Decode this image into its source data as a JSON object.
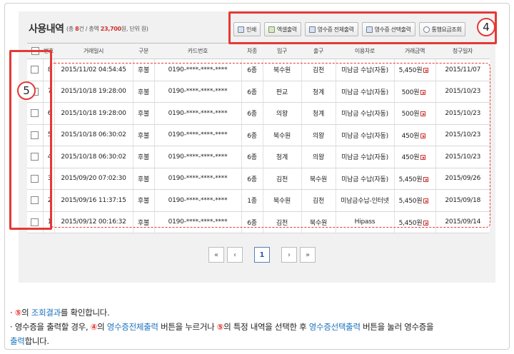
{
  "header": {
    "title": "사용내역",
    "summary_pre": "(총 ",
    "count": "8",
    "summary_mid": "건 / 총액 ",
    "total": "23,700",
    "summary_post": "원, 단위 원)"
  },
  "toolbar": {
    "print": "인쇄",
    "excel": "엑셀출력",
    "receipt_all": "영수증 전체출력",
    "receipt_selected": "영수증 선택출력",
    "fare_search": "통행요금조회"
  },
  "callouts": {
    "c4": "4",
    "c5": "5"
  },
  "table": {
    "headers": [
      "번호",
      "거래일시",
      "구분",
      "카드번호",
      "차종",
      "입구",
      "출구",
      "이용차로",
      "거래금액",
      "청구일자"
    ],
    "rows": [
      [
        "8",
        "2015/11/02 04:54:45",
        "후불",
        "0190-****-****-****",
        "6종",
        "북수원",
        "김천",
        "미남금 수납(자동)",
        "5,450원",
        "2015/11/07"
      ],
      [
        "7",
        "2015/10/18 19:28:00",
        "후불",
        "0190-****-****-****",
        "6종",
        "판교",
        "청계",
        "미남금 수납(자동)",
        "500원",
        "2015/10/23"
      ],
      [
        "6",
        "2015/10/18 19:28:00",
        "후불",
        "0190-****-****-****",
        "6종",
        "의왕",
        "청계",
        "미남금 수납(자동)",
        "500원",
        "2015/10/23"
      ],
      [
        "5",
        "2015/10/18 06:30:02",
        "후불",
        "0190-****-****-****",
        "6종",
        "북수원",
        "의왕",
        "미남금 수납(자동)",
        "450원",
        "2015/10/23"
      ],
      [
        "4",
        "2015/10/18 06:30:02",
        "후불",
        "0190-****-****-****",
        "6종",
        "청계",
        "의왕",
        "미남금 수납(자동)",
        "450원",
        "2015/10/23"
      ],
      [
        "3",
        "2015/09/20 07:02:30",
        "후불",
        "0190-****-****-****",
        "6종",
        "김천",
        "북수원",
        "미남금 수납(자동)",
        "5,450원",
        "2015/09/26"
      ],
      [
        "2",
        "2015/09/16 11:37:15",
        "후불",
        "0190-****-****-****",
        "1종",
        "북수원",
        "김천",
        "미남금수납-인터넷",
        "5,450원",
        "2015/09/18"
      ],
      [
        "1",
        "2015/09/12 00:16:32",
        "후불",
        "0190-****-****-****",
        "6종",
        "김천",
        "북수원",
        "Hipass",
        "5,450원",
        "2015/09/14"
      ]
    ]
  },
  "pager": {
    "first": "«",
    "prev": "‹",
    "current": "1",
    "next": "›",
    "last": "»"
  },
  "notes": {
    "n1_num": "⑤",
    "n1_a": "의 ",
    "n1_link": "조회결과",
    "n1_b": "를 확인합니다.",
    "n2_a": "영수증을 출력할 경우, ",
    "n2_num4": "④",
    "n2_b": "의 ",
    "n2_link1": "영수증전체출력",
    "n2_c": " 버튼을 누르거나 ",
    "n2_num5": "⑤",
    "n2_d": "의 특정 내역을 선택한 후 ",
    "n2_link2": "영수증선택출력",
    "n2_e": " 버튼을 눌러 영수증을",
    "n3_link": "출력",
    "n3_a": "합니다."
  }
}
